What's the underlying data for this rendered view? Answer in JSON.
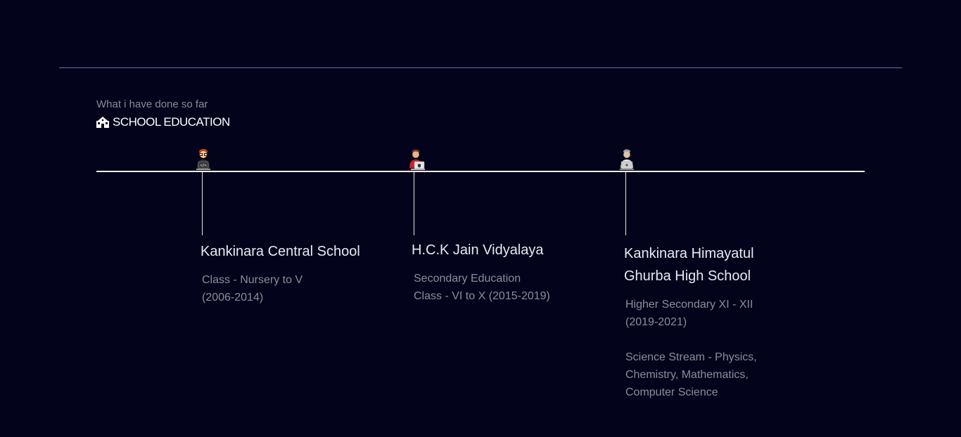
{
  "header": {
    "subtitle": "What i have done so far",
    "title": "SCHOOL EDUCATION",
    "title_icon": "school-icon"
  },
  "timeline": {
    "line_color": "#f0f0f0",
    "items": [
      {
        "avatar": "coder-avatar-icon",
        "name": "Kankinara Central School",
        "description": [
          "Class - Nursery to V",
          "(2006-2014)"
        ]
      },
      {
        "avatar": "laptop-avatar-icon",
        "name": "H.C.K Jain Vidyalaya",
        "description": [
          "Secondary Education",
          "Class - VI to X (2015-2019)"
        ]
      },
      {
        "avatar": "graduate-laptop-avatar-icon",
        "name_lines": [
          "Kankinara Himayatul",
          "Ghurba High School"
        ],
        "description": [
          "Higher Secondary XI - XII",
          "(2019-2021)"
        ],
        "description_extra": [
          "Science Stream - Physics,",
          "Chemistry, Mathematics,",
          "Computer Science"
        ]
      }
    ]
  },
  "colors": {
    "background": "#03031b",
    "divider": "#6f6fa8",
    "heading": "#e9e9f2",
    "muted": "#8d8d96"
  }
}
